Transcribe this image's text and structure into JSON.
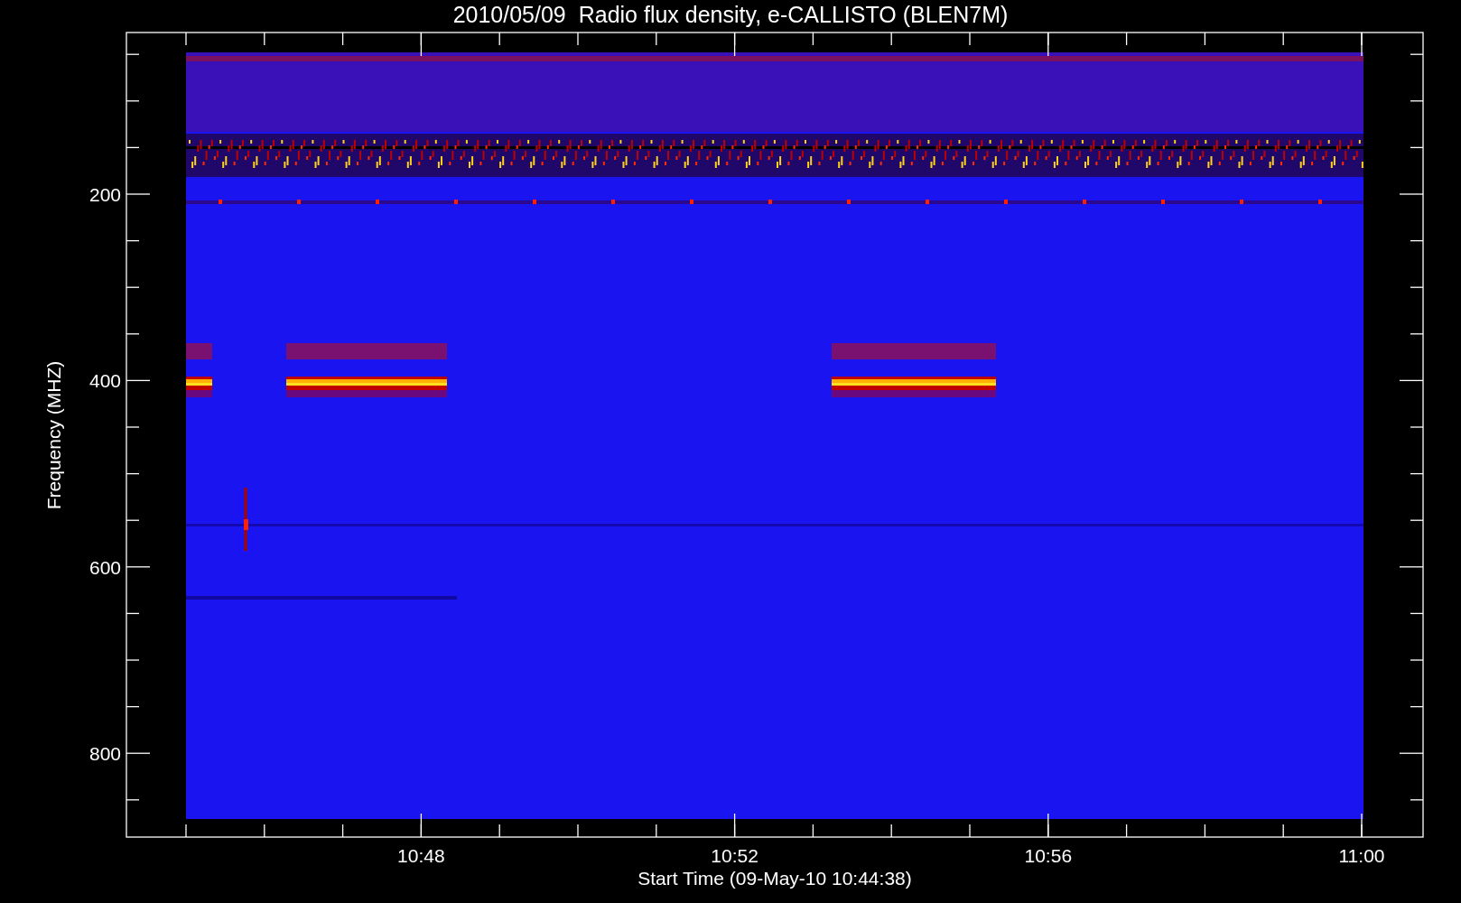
{
  "title": "2010/05/09  Radio flux density, e-CALLISTO (BLEN7M)",
  "y_axis": {
    "label": "Frequency (MHZ)",
    "ticks": [
      "200",
      "400",
      "600",
      "800"
    ]
  },
  "x_axis": {
    "label": "Start Time (09-May-10 10:44:38)",
    "ticks": [
      "10:48",
      "10:52",
      "10:56",
      "11:00"
    ]
  }
}
